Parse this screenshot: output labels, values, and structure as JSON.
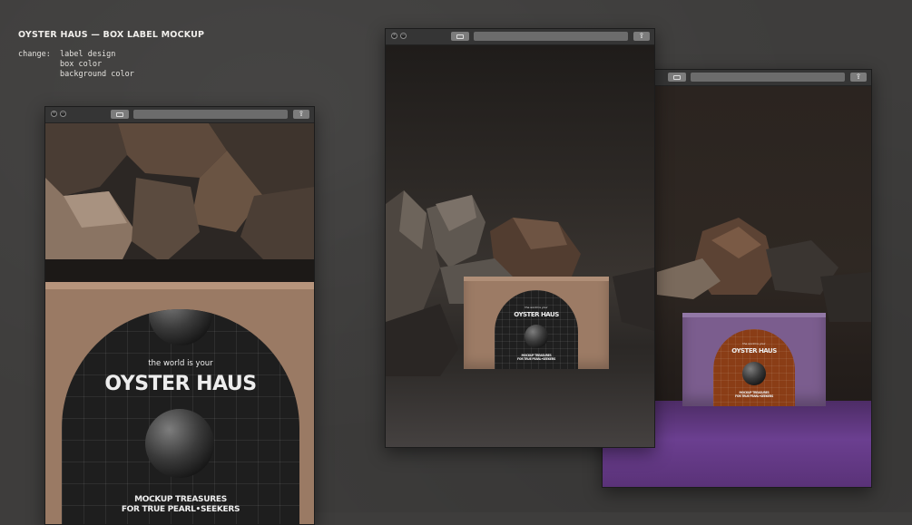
{
  "header": {
    "title": "OYSTER HAUS — BOX LABEL MOCKUP",
    "change_key": "change:",
    "changes": [
      "label design",
      "box color",
      "background color"
    ]
  },
  "windows": [
    {
      "id": "left",
      "share_icon": "share-icon",
      "label": {
        "tagline": "the world is your",
        "brand": "OYSTER HAUS",
        "footer_line1": "MOCKUP TREASURES",
        "footer_line2": "FOR TRUE PEARL•SEEKERS"
      },
      "colors": {
        "box": "#9a7a64",
        "label": "#1e1e1e",
        "background": "#2f2b28"
      }
    },
    {
      "id": "middle",
      "label": {
        "tagline": "the world is your",
        "brand": "OYSTER HAUS",
        "footer_line1": "MOCKUP TREASURES",
        "footer_line2": "FOR TRUE PEARL•SEEKERS"
      },
      "colors": {
        "box": "#9c7b65",
        "label": "#1f1f1f",
        "background": "#34302d"
      }
    },
    {
      "id": "right",
      "label": {
        "tagline": "the world is your",
        "brand": "OYSTER HAUS",
        "footer_line1": "MOCKUP TREASURES",
        "footer_line2": "FOR TRUE PEARL•SEEKERS"
      },
      "colors": {
        "box": "#7b5d8e",
        "label": "#8a3d16",
        "background": "#6a3d8c"
      }
    }
  ]
}
